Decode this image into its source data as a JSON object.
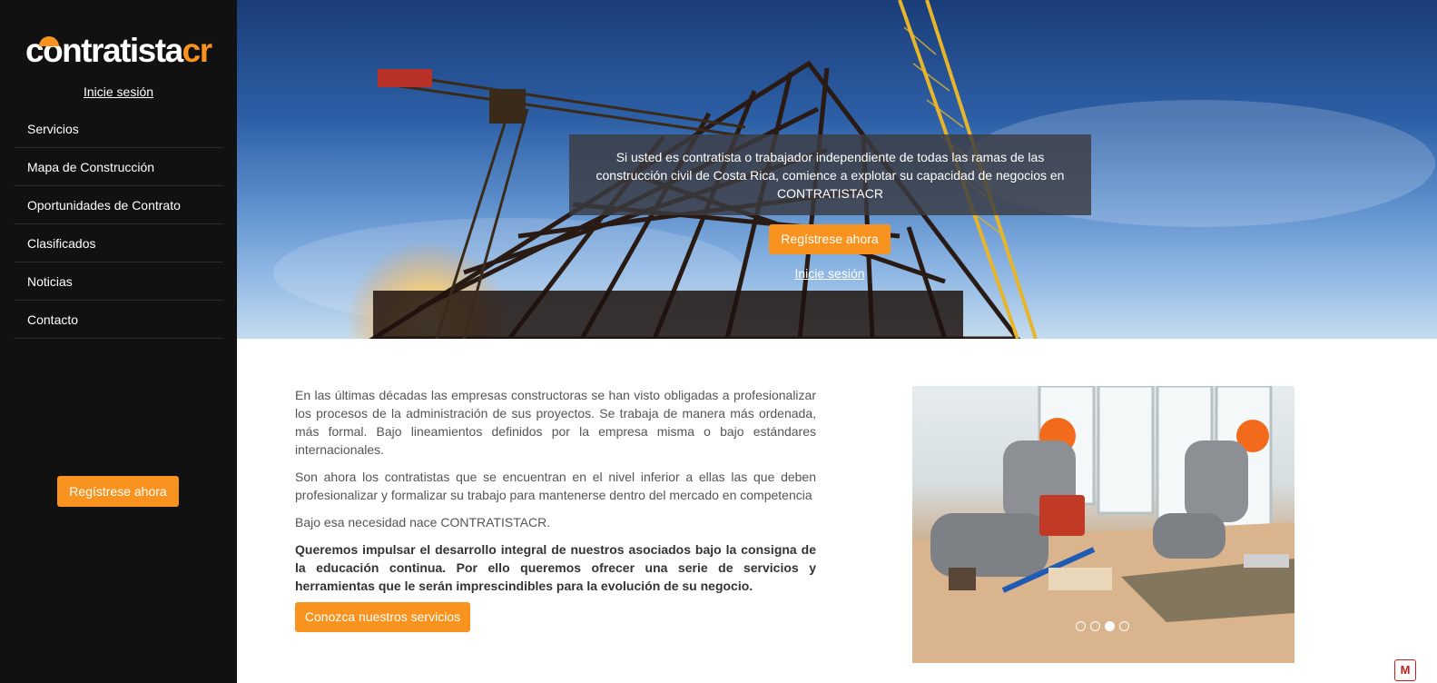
{
  "sidebar": {
    "logo": {
      "main": "contratista",
      "suffix": "cr"
    },
    "login_link": "Inicie sesión",
    "menu": [
      {
        "label": "Servicios"
      },
      {
        "label": "Mapa de Construcción"
      },
      {
        "label": "Oportunidades de Contrato"
      },
      {
        "label": "Clasificados"
      },
      {
        "label": "Noticias"
      },
      {
        "label": "Contacto"
      }
    ],
    "register_button": "Regístrese ahora"
  },
  "hero": {
    "message": "Si usted es contratista o trabajador independiente de todas las ramas de las construcción civil de Costa Rica, comience a explotar su capacidad de negocios en CONTRATISTACR",
    "register_button": "Regístrese ahora",
    "login_link": "Inicie sesión"
  },
  "main": {
    "paragraphs": [
      "En las últimas décadas las empresas constructoras se han visto obligadas a profesionalizar los procesos de la administración de sus proyectos. Se trabaja de manera más ordenada, más formal. Bajo lineamientos definidos por la empresa misma o bajo estándares internacionales.",
      "Son ahora los contratistas que se encuentran en el nivel inferior a ellas las que deben profesionalizar y formalizar su trabajo para mantenerse dentro del mercado en competencia",
      "Bajo esa necesidad nace CONTRATISTACR."
    ],
    "highlight": "Queremos impulsar el desarrollo integral de nuestros asociados bajo la consigna de la educación continua. Por ello queremos ofrecer una serie de servicios y herramientas que le serán imprescindibles para la evolución de su negocio.",
    "services_button": "Conozca nuestros servicios"
  },
  "carousel": {
    "slide_count": 4,
    "active_index": 2
  },
  "badge": {
    "label": "M"
  },
  "colors": {
    "accent": "#f7931e",
    "sidebar_bg": "#111111",
    "text": "#555555"
  }
}
